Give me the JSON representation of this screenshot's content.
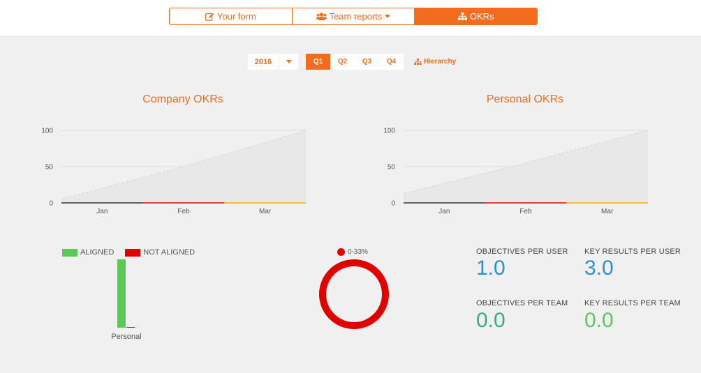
{
  "nav": {
    "tabs": [
      {
        "label": "Your form",
        "icon": "edit-icon"
      },
      {
        "label": "Team reports",
        "icon": "users-icon"
      },
      {
        "label": "OKRs",
        "icon": "sitemap-icon"
      }
    ],
    "active_tab": "OKRs",
    "accent": "#f26c1d"
  },
  "filters": {
    "year": "2016",
    "quarters": [
      "Q1",
      "Q2",
      "Q3",
      "Q4"
    ],
    "active_quarter": "Q1",
    "hierarchy_label": "Hierarchy"
  },
  "company_chart": {
    "title": "Company OKRs"
  },
  "personal_chart": {
    "title": "Personal OKRs"
  },
  "chart_data": [
    {
      "type": "line",
      "title": "Company OKRs",
      "categories": [
        "Jan",
        "Feb",
        "Mar"
      ],
      "y_ticks": [
        0,
        50,
        100
      ],
      "ylim": [
        0,
        100
      ],
      "series": [
        {
          "values": [
            5,
            50,
            100
          ],
          "color": "#dcdcdc",
          "style": "dashed-area"
        },
        {
          "values": [
            0,
            0,
            0
          ],
          "segment_colors": [
            "#333333",
            "#e10000",
            "#f2b100"
          ]
        }
      ],
      "grid": true
    },
    {
      "type": "line",
      "title": "Personal OKRs",
      "categories": [
        "Jan",
        "Feb",
        "Mar"
      ],
      "y_ticks": [
        0,
        50,
        100
      ],
      "ylim": [
        0,
        100
      ],
      "series": [
        {
          "values": [
            13,
            55,
            100
          ],
          "color": "#dcdcdc",
          "style": "dashed-area"
        },
        {
          "values": [
            0,
            0,
            0
          ],
          "segment_colors": [
            "#333333",
            "#e10000",
            "#f2b100"
          ]
        }
      ],
      "grid": true
    },
    {
      "type": "bar",
      "categories": [
        "Personal"
      ],
      "series": [
        {
          "name": "ALIGNED",
          "values": [
            100
          ],
          "color": "#5cc85c"
        },
        {
          "name": "NOT ALIGNED",
          "values": [
            0
          ],
          "color": "#e10000"
        }
      ],
      "ylim": [
        0,
        100
      ]
    },
    {
      "type": "pie",
      "variant": "donut",
      "slices": [
        {
          "label": "0-33%",
          "value": 100,
          "color": "#e10000"
        }
      ]
    }
  ],
  "stats": [
    {
      "label": "OBJECTIVES PER USER",
      "value": "1.0",
      "color": "#2a8fd6"
    },
    {
      "label": "KEY RESULTS PER USER",
      "value": "3.0",
      "color": "#2a8fd6"
    },
    {
      "label": "OBJECTIVES PER TEAM",
      "value": "0.0",
      "color": "#3aa88a"
    },
    {
      "label": "KEY RESULTS PER TEAM",
      "value": "0.0",
      "color": "#5cc85c"
    }
  ]
}
